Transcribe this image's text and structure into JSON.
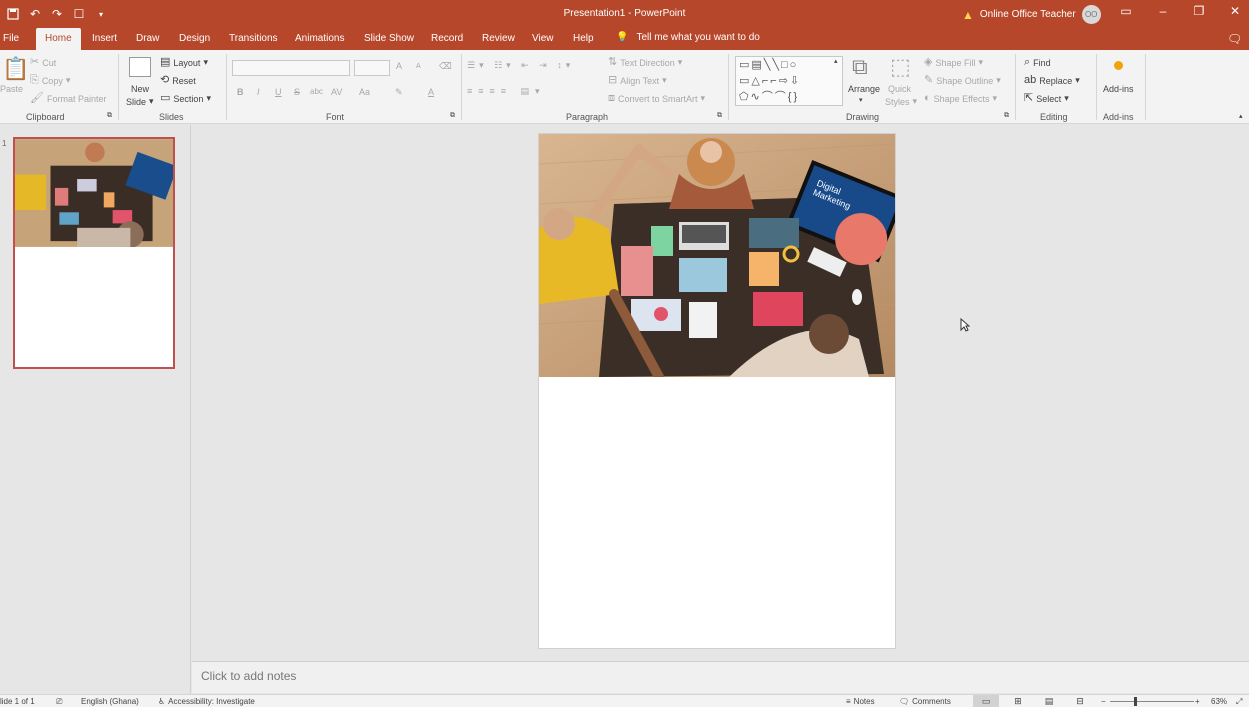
{
  "window": {
    "title": "Presentation1 - PowerPoint",
    "user": "Online Office Teacher",
    "user_initials": "OO"
  },
  "tabs": {
    "file": "File",
    "home": "Home",
    "insert": "Insert",
    "draw": "Draw",
    "design": "Design",
    "transitions": "Transitions",
    "animations": "Animations",
    "slideshow": "Slide Show",
    "record": "Record",
    "review": "Review",
    "view": "View",
    "help": "Help",
    "tellme": "Tell me what you want to do"
  },
  "ribbon": {
    "clipboard": {
      "paste": "Paste",
      "cut": "Cut",
      "copy": "Copy",
      "format_painter": "Format Painter",
      "label": "Clipboard"
    },
    "slides": {
      "new_slide_1": "New",
      "new_slide_2": "Slide",
      "layout": "Layout",
      "reset": "Reset",
      "section": "Section",
      "label": "Slides"
    },
    "font": {
      "bold": "B",
      "italic": "I",
      "underline": "U",
      "strike": "S",
      "shadow": "abc",
      "spacing": "AV",
      "case": "Aa",
      "grow": "A",
      "shrink": "A",
      "color": "A",
      "label": "Font"
    },
    "paragraph": {
      "text_direction": "Text Direction",
      "align_text": "Align Text",
      "smartart": "Convert to SmartArt",
      "label": "Paragraph"
    },
    "drawing": {
      "arrange": "Arrange",
      "quick_styles_1": "Quick",
      "quick_styles_2": "Styles",
      "shape_fill": "Shape Fill",
      "shape_outline": "Shape Outline",
      "shape_effects": "Shape Effects",
      "label": "Drawing"
    },
    "editing": {
      "find": "Find",
      "replace": "Replace",
      "select": "Select",
      "label": "Editing"
    },
    "addins": {
      "button": "Add-ins",
      "label": "Add-ins"
    }
  },
  "thumbnails": {
    "slide_number": "1"
  },
  "slide": {
    "photo_text_1": "Digital",
    "photo_text_2": "Marketing"
  },
  "notes": {
    "placeholder": "Click to add notes"
  },
  "status": {
    "slide_count": "lide 1 of 1",
    "language": "English (Ghana)",
    "accessibility": "Accessibility: Investigate",
    "notes": "Notes",
    "comments": "Comments",
    "zoom": "63%"
  },
  "colors": {
    "accent": "#b7472a",
    "thumb_border": "#c0504d"
  }
}
